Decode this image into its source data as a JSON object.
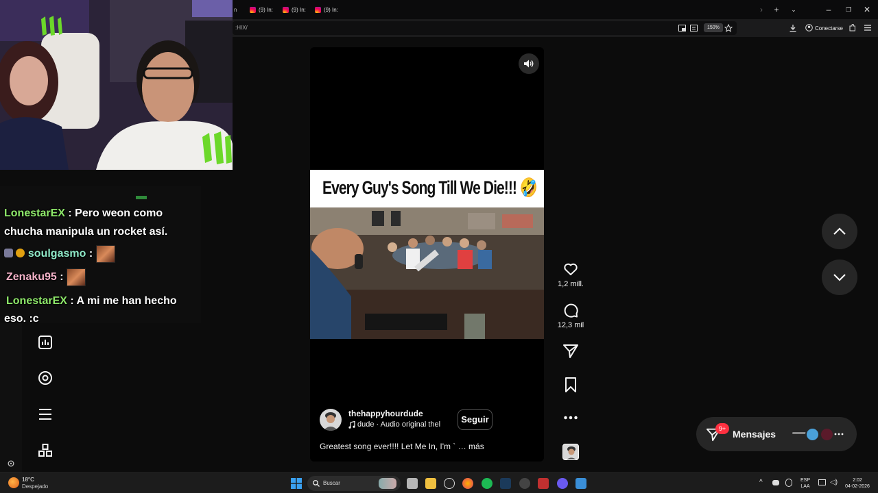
{
  "browser": {
    "tabs": [
      {
        "label": "(9) In:"
      },
      {
        "label": "(9) In:"
      },
      {
        "label": "(9) In:"
      }
    ],
    "url": ":HIX/",
    "zoom": "150%",
    "connect_label": "Conectarse"
  },
  "stream_chat": {
    "messages": [
      {
        "user": "LonestarEX",
        "sep": " : ",
        "text": "Pero weon como"
      },
      {
        "continuation": "chucha manipula un rocket así."
      },
      {
        "user": "soulgasmo",
        "sep": " : "
      },
      {
        "user": "Zenaku95",
        "sep": " : "
      },
      {
        "user": "LonestarEX",
        "sep": " : ",
        "text": "A mi me han hecho"
      },
      {
        "continuation": "eso. :c"
      }
    ]
  },
  "reel": {
    "overlay_title": "Every Guy's Song Till We Die!!! 🤣",
    "username": "thehappyhourdude",
    "follow_label": "Seguir",
    "audio": "dude · Audio original  thel",
    "caption": "Greatest song ever!!!! Let Me In, I'm ` … más",
    "likes": "1,2 mill.",
    "comments": "12,3 mil"
  },
  "messages_button": {
    "label": "Mensajes",
    "badge": "9+"
  },
  "taskbar": {
    "weather_temp": "18°C",
    "weather_desc": "Despejado",
    "search_label": "Buscar",
    "lang_top": "ESP",
    "lang_bottom": "LAA",
    "time": "2:02",
    "date": "04-02-2026"
  },
  "colors": {
    "accent_red": "#ff3040",
    "chat_green": "#8ee86a"
  }
}
